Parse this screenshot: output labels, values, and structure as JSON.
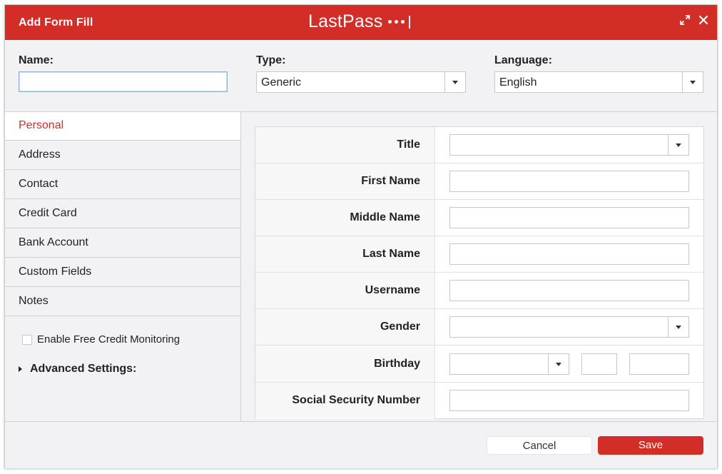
{
  "window": {
    "title": "Add Form Fill",
    "logo": "LastPass",
    "icons": [
      "expand-icon",
      "close-icon"
    ]
  },
  "top_fields": {
    "name_label": "Name:",
    "name_value": "",
    "type_label": "Type:",
    "type_value": "Generic",
    "language_label": "Language:",
    "language_value": "English"
  },
  "sidebar": {
    "items": [
      {
        "label": "Personal",
        "active": true
      },
      {
        "label": "Address"
      },
      {
        "label": "Contact"
      },
      {
        "label": "Credit Card"
      },
      {
        "label": "Bank Account"
      },
      {
        "label": "Custom Fields"
      },
      {
        "label": "Notes"
      }
    ],
    "credit_monitoring_label": "Enable Free Credit Monitoring",
    "credit_monitoring_checked": false,
    "advanced_label": "Advanced Settings:"
  },
  "form": {
    "fields": [
      {
        "label": "Title",
        "kind": "select",
        "value": ""
      },
      {
        "label": "First Name",
        "kind": "text",
        "value": ""
      },
      {
        "label": "Middle Name",
        "kind": "text",
        "value": ""
      },
      {
        "label": "Last Name",
        "kind": "text",
        "value": ""
      },
      {
        "label": "Username",
        "kind": "text",
        "value": ""
      },
      {
        "label": "Gender",
        "kind": "select",
        "value": ""
      },
      {
        "label": "Birthday",
        "kind": "date",
        "value": ""
      },
      {
        "label": "Social Security Number",
        "kind": "text",
        "value": ""
      }
    ]
  },
  "footer": {
    "cancel_label": "Cancel",
    "save_label": "Save"
  },
  "colors": {
    "brand_red": "#d32d27",
    "background": "#f2f2f4"
  }
}
